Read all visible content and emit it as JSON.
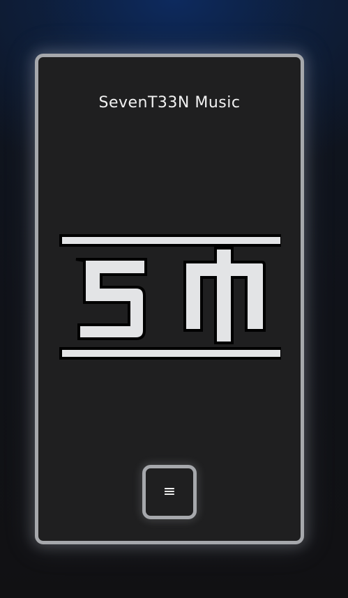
{
  "header": {
    "site_title": "SevenT33N Music"
  },
  "logo": {
    "text": "SM",
    "fill_color": "#e3e4e6",
    "outline_color": "#000000"
  },
  "menu": {
    "button_icon": "hamburger-icon",
    "button_glyph": "≡"
  },
  "colors": {
    "card_background": "#1f1f20",
    "card_border": "#a6a8ac",
    "page_background_top": "#0d2a5e",
    "page_background_bottom": "#111113"
  }
}
